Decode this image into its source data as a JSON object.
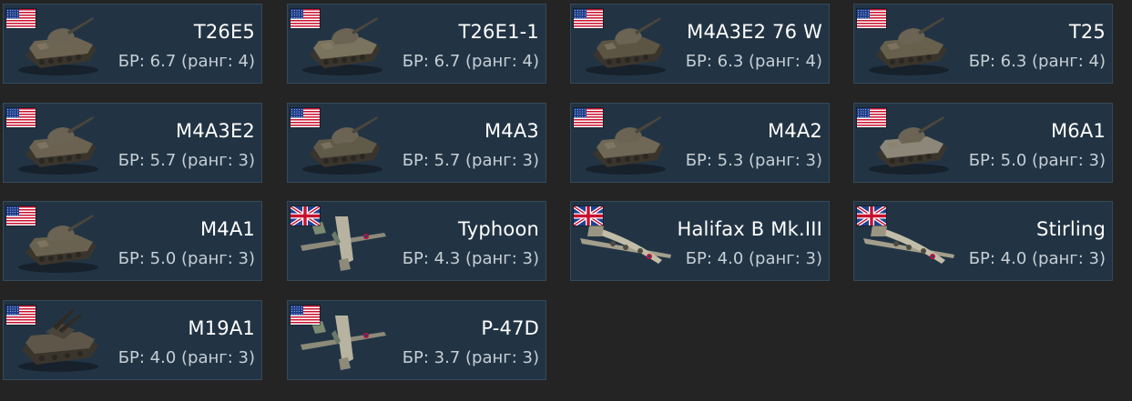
{
  "vehicles": [
    {
      "name": "T26E5",
      "br": "БР: 6.7 (ранг: 4)",
      "flag": "usa-flag",
      "kind": "tank"
    },
    {
      "name": "T26E1-1",
      "br": "БР: 6.7 (ранг: 4)",
      "flag": "usa-flag",
      "kind": "tank"
    },
    {
      "name": "M4A3E2 76 W",
      "br": "БР: 6.3 (ранг: 4)",
      "flag": "usa-flag",
      "kind": "tank"
    },
    {
      "name": "T25",
      "br": "БР: 6.3 (ранг: 4)",
      "flag": "usa-flag",
      "kind": "tank"
    },
    {
      "name": "M4A3E2",
      "br": "БР: 5.7 (ранг: 3)",
      "flag": "usa-flag",
      "kind": "tank"
    },
    {
      "name": "M4A3",
      "br": "БР: 5.7 (ранг: 3)",
      "flag": "usa-flag",
      "kind": "tank"
    },
    {
      "name": "M4A2",
      "br": "БР: 5.3 (ранг: 3)",
      "flag": "usa-flag",
      "kind": "tank"
    },
    {
      "name": "M6A1",
      "br": "БР: 5.0 (ранг: 3)",
      "flag": "usa-flag",
      "kind": "tank"
    },
    {
      "name": "M4A1",
      "br": "БР: 5.0 (ранг: 3)",
      "flag": "usa-flag",
      "kind": "tank"
    },
    {
      "name": "Typhoon",
      "br": "БР: 4.3 (ранг: 3)",
      "flag": "uk-flag",
      "kind": "fighter"
    },
    {
      "name": "Halifax B Mk.III",
      "br": "БР: 4.0 (ранг: 3)",
      "flag": "uk-flag",
      "kind": "bomber"
    },
    {
      "name": "Stirling",
      "br": "БР: 4.0 (ранг: 3)",
      "flag": "uk-flag",
      "kind": "bomber"
    },
    {
      "name": "M19A1",
      "br": "БР: 4.0 (ранг: 3)",
      "flag": "usa-flag",
      "kind": "spaa"
    },
    {
      "name": "P-47D",
      "br": "БР: 3.7 (ранг: 3)",
      "flag": "usa-flag",
      "kind": "fighter"
    }
  ],
  "colors": {
    "background": "#242424",
    "card_bg": "#223444",
    "card_border": "#34495a",
    "name_text": "#ffffff",
    "br_text": "#c7ced4"
  }
}
